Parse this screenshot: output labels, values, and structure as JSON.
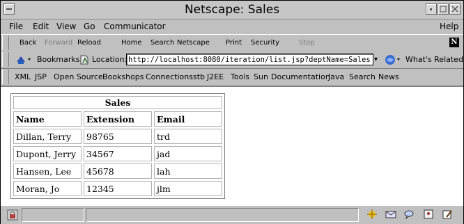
{
  "window": {
    "title": "Netscape: Sales"
  },
  "menubar": {
    "file": "File",
    "edit": "Edit",
    "view": "View",
    "go": "Go",
    "communicator": "Communicator",
    "help": "Help"
  },
  "toolbar": {
    "back": "Back",
    "forward": "Forward",
    "reload": "Reload",
    "home": "Home",
    "search": "Search",
    "netscape": "Netscape",
    "print": "Print",
    "security": "Security",
    "stop": "Stop",
    "logo": "N"
  },
  "location": {
    "bookmarks": "Bookmarks",
    "label": "Location:",
    "url": "http://localhost:8080/iteration/list.jsp?deptName=Sales",
    "whats_related": "What's Related"
  },
  "personal_toolbar": {
    "items": [
      "XML",
      "JSP",
      "Open Source",
      "Bookshops",
      "Connections",
      "stb",
      "J2EE",
      "Tools",
      "Sun",
      "Documentation",
      "Java",
      "Search",
      "News"
    ]
  },
  "table": {
    "caption": "Sales",
    "headers": [
      "Name",
      "Extension",
      "Email"
    ],
    "rows": [
      [
        "Dillan, Terry",
        "98765",
        "trd"
      ],
      [
        "Dupont, Jerry",
        "34567",
        "jad"
      ],
      [
        "Hansen, Lee",
        "45678",
        "lah"
      ],
      [
        "Moran, Jo",
        "12345",
        "jlm"
      ]
    ]
  },
  "colors": {
    "chrome": "#c0c0c0",
    "content_bg": "#ffffff",
    "disabled_text": "#7d7d7d"
  }
}
